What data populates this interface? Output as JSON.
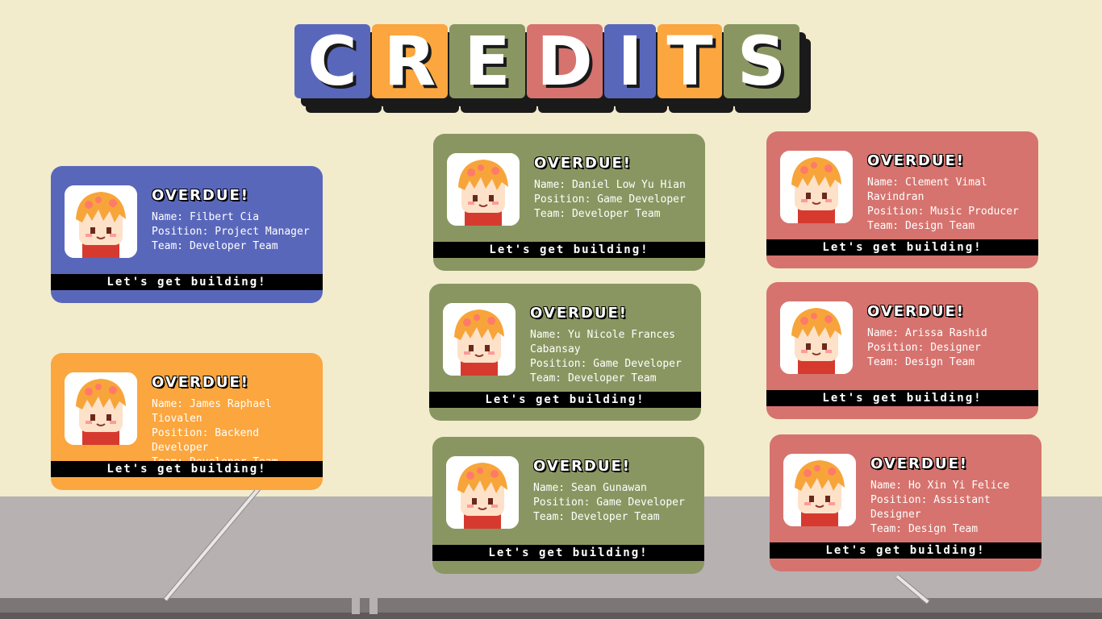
{
  "title": {
    "letters": [
      {
        "char": "C",
        "color": "#5967bb"
      },
      {
        "char": "R",
        "color": "#fba63e"
      },
      {
        "char": "E",
        "color": "#8a9661"
      },
      {
        "char": "D",
        "color": "#d6736e"
      },
      {
        "char": "I",
        "color": "#5967bb"
      },
      {
        "char": "T",
        "color": "#fba63e"
      },
      {
        "char": "S",
        "color": "#8a9661"
      }
    ]
  },
  "cards": [
    {
      "studio": "OVERDUE!",
      "name": "Name: Filbert Cia",
      "position": "Position: Project Manager",
      "team": "Team: Developer Team",
      "tagline": "Let's get building!",
      "color": "blue"
    },
    {
      "studio": "OVERDUE!",
      "name": "Name: James Raphael Tiovalen",
      "position": "Position: Backend Developer",
      "team": "Team: Developer Team",
      "tagline": "Let's get building!",
      "color": "orange"
    },
    {
      "studio": "OVERDUE!",
      "name": "Name: Daniel Low Yu Hian",
      "position": "Position: Game Developer",
      "team": "Team: Developer Team",
      "tagline": "Let's get building!",
      "color": "green"
    },
    {
      "studio": "OVERDUE!",
      "name": "Name: Yu Nicole Frances Cabansay",
      "position": "Position: Game Developer",
      "team": "Team: Developer Team",
      "tagline": "Let's get building!",
      "color": "green"
    },
    {
      "studio": "OVERDUE!",
      "name": "Name: Sean Gunawan",
      "position": "Position: Game Developer",
      "team": "Team: Developer Team",
      "tagline": "Let's get building!",
      "color": "green"
    },
    {
      "studio": "OVERDUE!",
      "name": "Name: Clement Vimal Ravindran",
      "position": "Position: Music Producer",
      "team": "Team: Design Team",
      "tagline": "Let's get building!",
      "color": "red"
    },
    {
      "studio": "OVERDUE!",
      "name": "Name: Arissa Rashid",
      "position": "Position: Designer",
      "team": "Team: Design Team",
      "tagline": "Let's get building!",
      "color": "red"
    },
    {
      "studio": "OVERDUE!",
      "name": "Name: Ho Xin Yi Felice",
      "position": "Position: Assistant Designer",
      "team": "Team: Design Team",
      "tagline": "Let's get building!",
      "color": "red"
    }
  ]
}
